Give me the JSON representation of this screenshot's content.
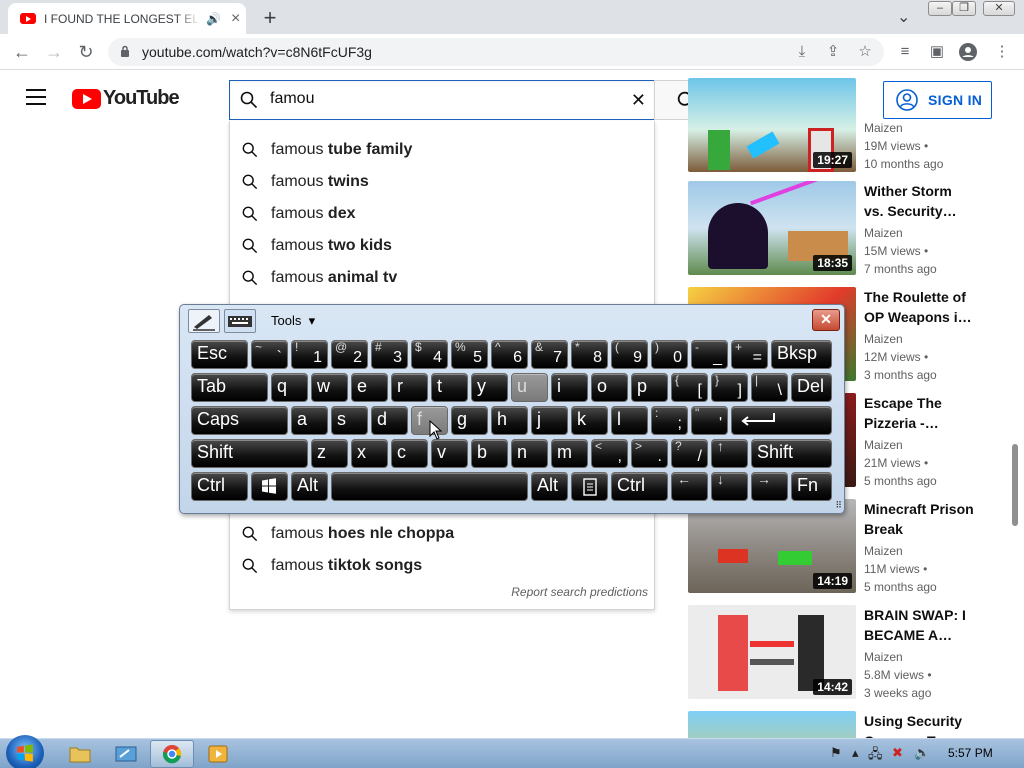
{
  "browser": {
    "tab_title": "I FOUND THE LONGEST ELEVATOR",
    "new_tab": "+",
    "url": "youtube.com/watch?v=c8N6tFcUF3g"
  },
  "youtube": {
    "logo_text": "YouTube",
    "search_value": "famou",
    "sign_in": "SIGN IN",
    "suggestions": [
      {
        "pre": "famous ",
        "rest": "tube family"
      },
      {
        "pre": "famous ",
        "rest": "twins"
      },
      {
        "pre": "famous ",
        "rest": "dex"
      },
      {
        "pre": "famous ",
        "rest": "two kids"
      },
      {
        "pre": "famous ",
        "rest": "animal tv"
      },
      {
        "pre": "famous ",
        "rest": "hoes nle choppa"
      },
      {
        "pre": "famous ",
        "rest": "tiktok songs"
      }
    ],
    "report": "Report search predictions",
    "sidebar": [
      {
        "title": "",
        "channel": "Maizen",
        "views": "19M views •",
        "age": "10 months ago",
        "duration": "19:27"
      },
      {
        "title": "Wither Storm vs. Security…",
        "channel": "Maizen",
        "views": "15M views •",
        "age": "7 months ago",
        "duration": "18:35"
      },
      {
        "title": "The Roulette of OP Weapons i…",
        "channel": "Maizen",
        "views": "12M views •",
        "age": "3 months ago",
        "duration": ""
      },
      {
        "title": "Escape The Pizzeria -…",
        "channel": "Maizen",
        "views": "21M views •",
        "age": "5 months ago",
        "duration": ""
      },
      {
        "title": "Minecraft Prison Break",
        "channel": "Maizen",
        "views": "11M views •",
        "age": "5 months ago",
        "duration": "14:19"
      },
      {
        "title": "BRAIN SWAP: I BECAME A…",
        "channel": "Maizen",
        "views": "5.8M views •",
        "age": "3 weeks ago",
        "duration": "14:42"
      },
      {
        "title": "Using Security Cameras To…",
        "channel": "",
        "views": "",
        "age": "",
        "duration": ""
      }
    ]
  },
  "osk": {
    "tools": "Tools",
    "close": "✕",
    "keys": {
      "esc": "Esc",
      "tab": "Tab",
      "caps": "Caps",
      "shift": "Shift",
      "shift_r": "Shift",
      "bksp": "Bksp",
      "del": "Del",
      "ctrl": "Ctrl",
      "ctrl_r": "Ctrl",
      "alt": "Alt",
      "alt_r": "Alt",
      "fn": "Fn",
      "row1": [
        [
          "~",
          "`"
        ],
        [
          "!",
          "1"
        ],
        [
          "@",
          "2"
        ],
        [
          "#",
          "3"
        ],
        [
          "$",
          "4"
        ],
        [
          "%",
          "5"
        ],
        [
          "^",
          "6"
        ],
        [
          "&",
          "7"
        ],
        [
          "*",
          "8"
        ],
        [
          "(",
          "9"
        ],
        [
          ")",
          "0"
        ],
        [
          "-",
          "_"
        ],
        [
          "+",
          "="
        ]
      ],
      "row2": [
        "q",
        "w",
        "e",
        "r",
        "t",
        "y",
        "u",
        "i",
        "o",
        "p"
      ],
      "row2_sym": [
        [
          "{",
          "["
        ],
        [
          "}",
          "]"
        ],
        [
          "|",
          "\\"
        ]
      ],
      "row3": [
        "a",
        "s",
        "d",
        "f",
        "g",
        "h",
        "j",
        "k",
        "l"
      ],
      "row3_sym": [
        [
          ":",
          ";"
        ],
        [
          "\"",
          "'"
        ]
      ],
      "row4": [
        "z",
        "x",
        "c",
        "v",
        "b",
        "n",
        "m"
      ],
      "row4_sym": [
        [
          "<",
          ","
        ],
        [
          ">",
          "."
        ],
        [
          "?",
          "/"
        ]
      ],
      "arrows": [
        "↑",
        "←",
        "↓",
        "→"
      ]
    }
  },
  "taskbar": {
    "time": "5:57 PM"
  },
  "colors": {
    "accent": "#065fd4",
    "yt_red": "#ff0000"
  }
}
